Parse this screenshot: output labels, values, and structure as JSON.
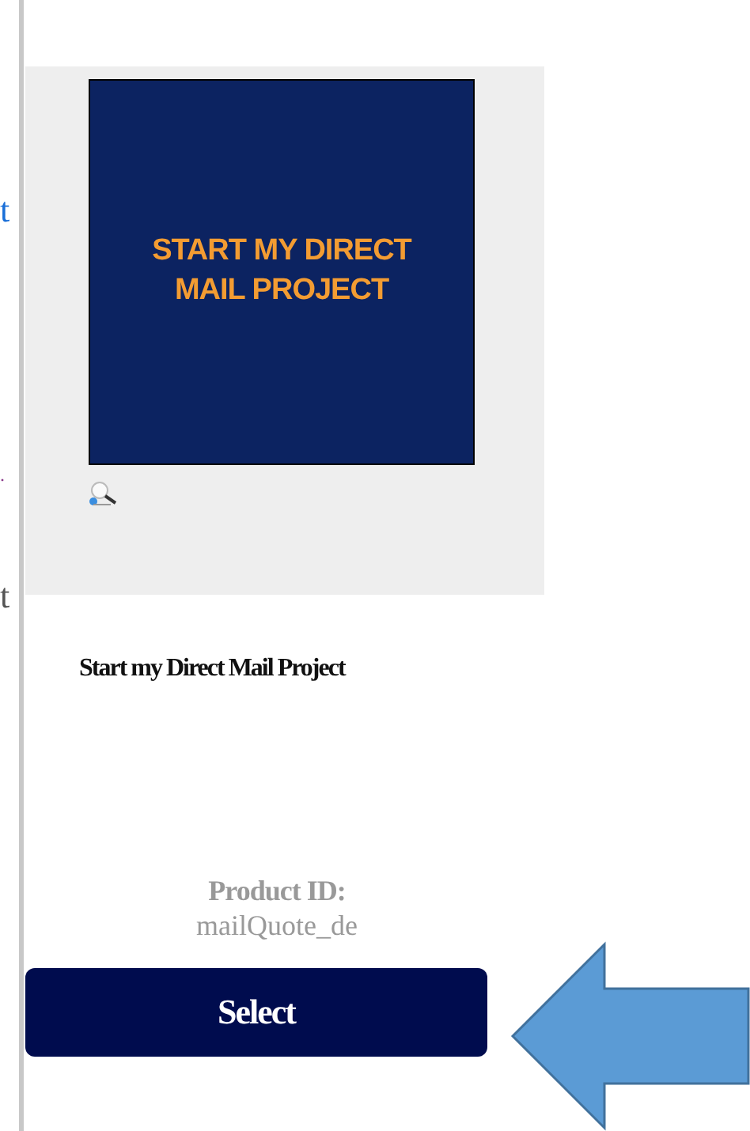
{
  "left_column_fragments": [
    {
      "text": "t",
      "kind": "link"
    },
    {
      "text": ".",
      "kind": "plain"
    },
    {
      "text": "t",
      "kind": "plain"
    }
  ],
  "product": {
    "image_text": "START MY DIRECT MAIL PROJECT",
    "title": "Start my Direct Mail Project",
    "id_label": "Product ID:",
    "id_value": "mailQuote_de",
    "button": "Select"
  }
}
